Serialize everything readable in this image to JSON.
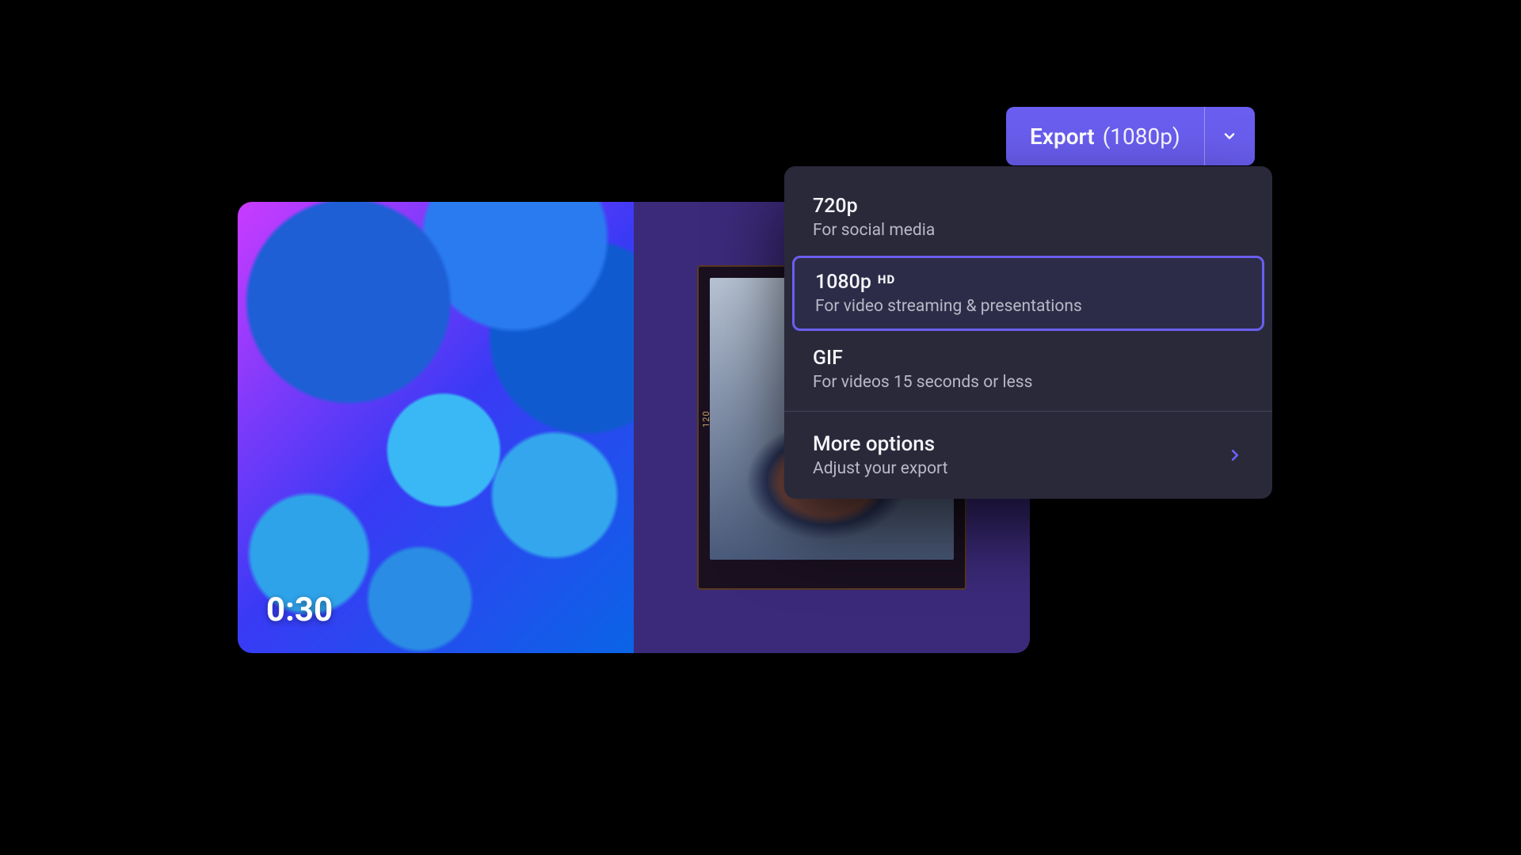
{
  "preview": {
    "timestamp": "0:30",
    "frame_number": "120"
  },
  "export_button": {
    "label": "Export",
    "current_resolution": "(1080p)"
  },
  "export_options": [
    {
      "title": "720p",
      "subtitle": "For social media",
      "badge": "",
      "selected": false
    },
    {
      "title": "1080p",
      "subtitle": "For video streaming & presentations",
      "badge": "HD",
      "selected": true
    },
    {
      "title": "GIF",
      "subtitle": "For videos 15 seconds or less",
      "badge": "",
      "selected": false
    }
  ],
  "more_options": {
    "title": "More options",
    "subtitle": "Adjust your export"
  }
}
